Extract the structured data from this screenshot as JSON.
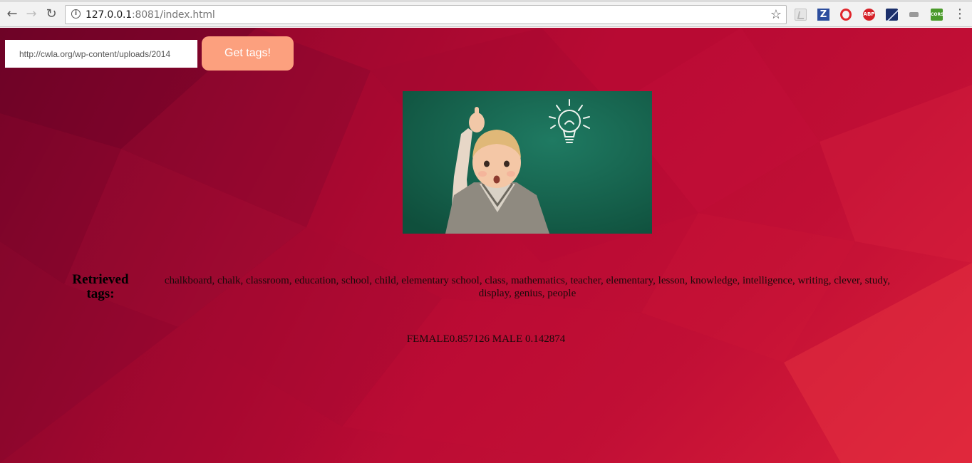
{
  "browser": {
    "url_host": "127.0.0.1",
    "url_rest": ":8081/index.html",
    "back_icon": "arrow-left",
    "forward_icon": "arrow-right",
    "reload_icon": "reload",
    "info_icon": "info-circle",
    "bookmark_icon": "star-outline",
    "extensions": [
      "pdf-icon",
      "zotero-icon",
      "opera-icon",
      "adblock-plus-icon",
      "profile-icon",
      "gray-extension-icon",
      "cors-icon"
    ],
    "ext_z_label": "Z",
    "ext_abp_label": "ABP",
    "ext_cors_label": "CORS",
    "menu_icon": "vertical-dots"
  },
  "form": {
    "url_value": "http://cwla.org/wp-content/uploads/2014",
    "button_label": "Get tags!"
  },
  "results": {
    "tags_label": "Retrieved tags:",
    "tags": "chalkboard, chalk, classroom, education, school, child, elementary school, class, mathematics, teacher, elementary, lesson, knowledge, intelligence, writing, clever, study, display, genius, people",
    "gender": "FEMALE0.857126 MALE 0.142874"
  },
  "colors": {
    "background_red": "#b80a33",
    "button_peach": "#fca07e",
    "chalkboard_green": "#17654f"
  }
}
